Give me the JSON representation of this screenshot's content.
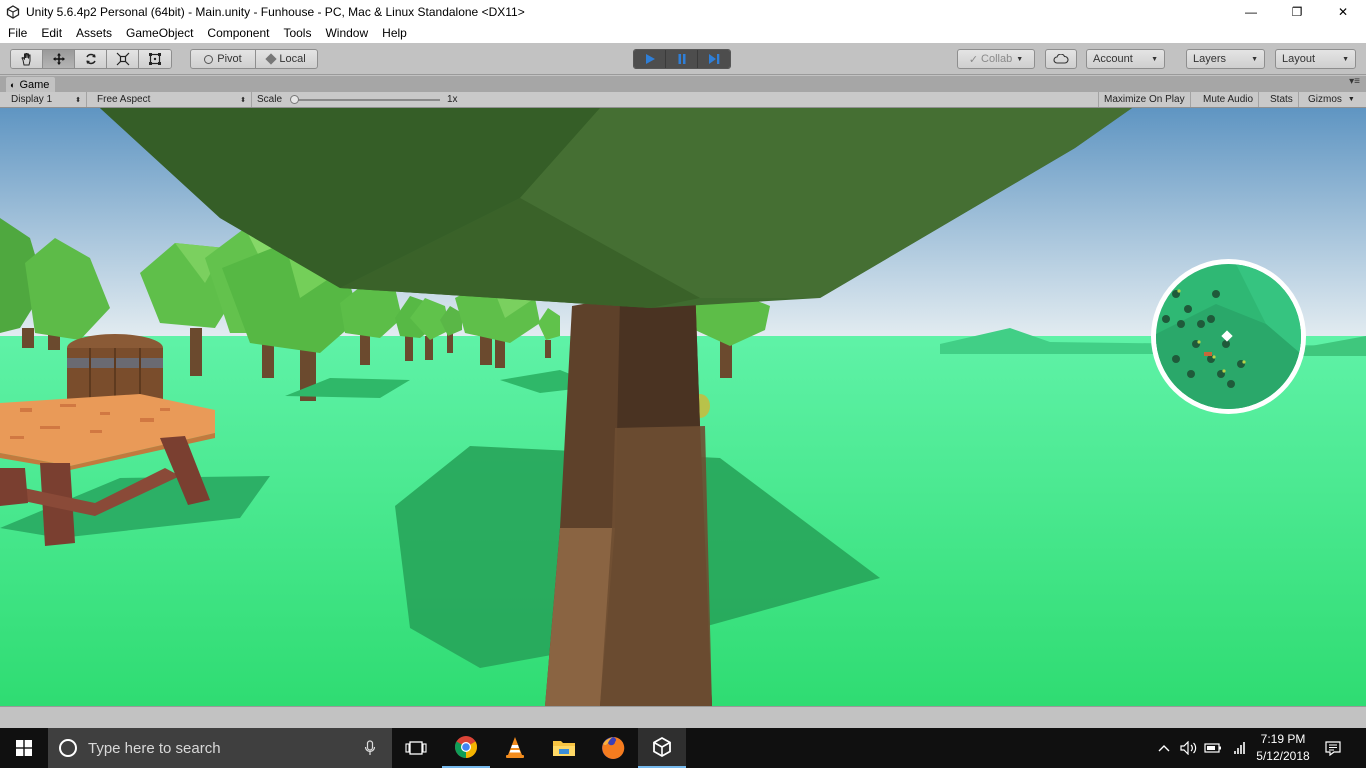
{
  "window": {
    "title": "Unity 5.6.4p2 Personal (64bit) - Main.unity - Funhouse - PC, Mac & Linux Standalone <DX11>",
    "minimize_glyph": "—",
    "restore_glyph": "❐",
    "close_glyph": "✕"
  },
  "menu": {
    "items": [
      "File",
      "Edit",
      "Assets",
      "GameObject",
      "Component",
      "Tools",
      "Window",
      "Help"
    ]
  },
  "toolbar": {
    "tools": [
      "hand-tool",
      "move-tool",
      "rotate-tool",
      "scale-tool",
      "rect-tool"
    ],
    "active_tool": "move-tool",
    "pivot_label": "Pivot",
    "local_label": "Local",
    "collab_label": "Collab",
    "account_label": "Account",
    "layers_label": "Layers",
    "layout_label": "Layout",
    "play_state": "playing",
    "accent_color": "#2f7fd8"
  },
  "game_tab": {
    "label": "Game"
  },
  "game_bar": {
    "display": "Display 1",
    "aspect": "Free Aspect",
    "scale_label": "Scale",
    "scale_value": "1x",
    "maximize_on_play": "Maximize On Play",
    "mute_audio": "Mute Audio",
    "stats": "Stats",
    "gizmos": "Gizmos"
  },
  "scene": {
    "sky_color": "#9ec4dc",
    "ground_color": "#3ce88a",
    "trunk_color": "#6b4a2e",
    "canopy_color": "#3e6b2e"
  },
  "taskbar": {
    "search_placeholder": "Type here to search",
    "time": "7:19 PM",
    "date": "5/12/2018",
    "pinned": [
      "task-view",
      "chrome",
      "vlc",
      "file-explorer",
      "firefox",
      "unity"
    ]
  }
}
